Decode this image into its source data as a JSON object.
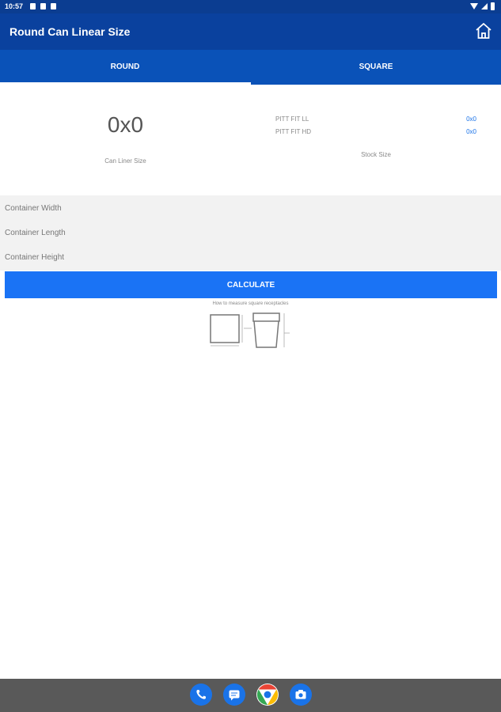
{
  "status_bar": {
    "time": "10:57"
  },
  "app_bar": {
    "title": "Round Can Linear Size"
  },
  "tabs": [
    {
      "label": "ROUND",
      "selected": true
    },
    {
      "label": "SQUARE",
      "selected": false
    }
  ],
  "result": {
    "can_liner_size": "0x0",
    "can_liner_label": "Can Liner Size",
    "stock": [
      {
        "name": "PITT FIT LL",
        "value": "0x0"
      },
      {
        "name": "PITT FIT HD",
        "value": "0x0"
      }
    ],
    "stock_label": "Stock Size"
  },
  "inputs": {
    "width_placeholder": "Container Width",
    "length_placeholder": "Container Length",
    "height_placeholder": "Container Height"
  },
  "calculate_label": "CALCULATE",
  "howto_text": "How to measure square receptacles",
  "dock_apps": [
    "phone-icon",
    "messages-icon",
    "chrome-icon",
    "camera-icon"
  ],
  "colors": {
    "status_bar": "#0b3d91",
    "app_bar": "#0a419e",
    "tab_bar": "#0a52b8",
    "button": "#1a73f5",
    "link_value": "#1a73e8",
    "nav_bar": "#595959"
  }
}
